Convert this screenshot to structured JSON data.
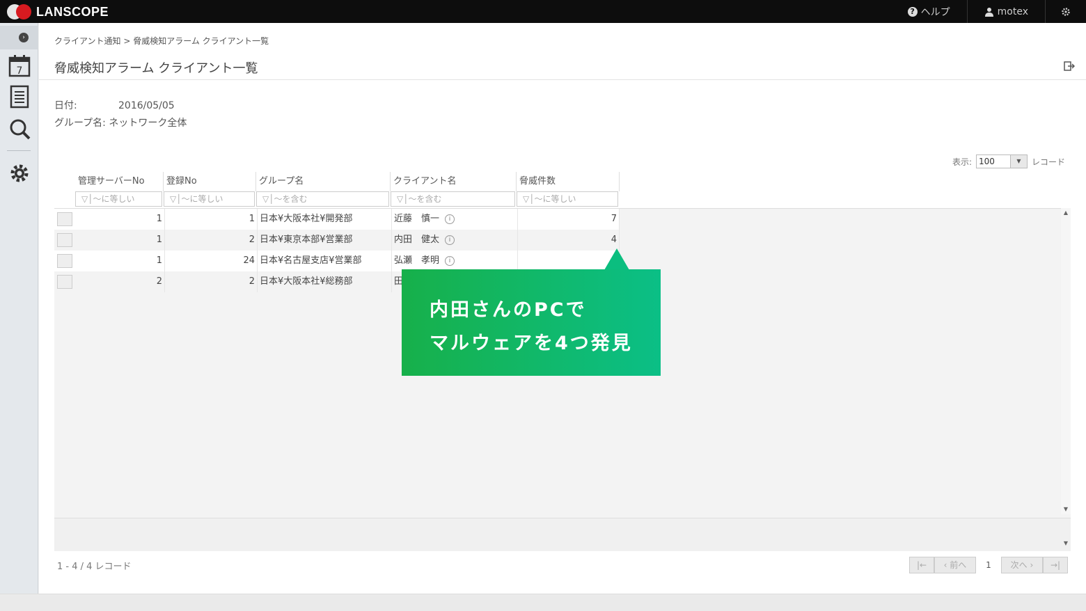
{
  "app": {
    "brand": "LANSCOPE",
    "help_label": "ヘルプ",
    "user_label": "motex"
  },
  "breadcrumb": {
    "text": "クライアント通知 > 脅威検知アラーム クライアント一覧"
  },
  "page": {
    "title": "脅威検知アラーム クライアント一覧"
  },
  "meta": {
    "date_label": "日付:",
    "date_value": "2016/05/05",
    "group_label": "グループ名:",
    "group_value": "ネットワーク全体"
  },
  "pagesize": {
    "label": "表示:",
    "value": "100",
    "suffix": "レコード"
  },
  "table": {
    "columns": [
      "管理サーバーNo",
      "登録No",
      "グループ名",
      "クライアント名",
      "脅威件数"
    ],
    "filters": [
      "▽│～に等しい",
      "▽│～に等しい",
      "▽│～を含む",
      "▽│～を含む",
      "▽│～に等しい"
    ],
    "rows": [
      {
        "server": "1",
        "reg": "1",
        "group": "日本¥大阪本社¥開発部",
        "client": "近藤　慎一",
        "count": "7"
      },
      {
        "server": "1",
        "reg": "2",
        "group": "日本¥東京本部¥営業部",
        "client": "内田　健太",
        "count": "4"
      },
      {
        "server": "1",
        "reg": "24",
        "group": "日本¥名古屋支店¥営業部",
        "client": "弘瀬　孝明",
        "count": ""
      },
      {
        "server": "2",
        "reg": "2",
        "group": "日本¥大阪本社¥総務部",
        "client": "田",
        "count": ""
      }
    ]
  },
  "footer": {
    "record_count": "1 - 4 / 4 レコード",
    "prev_label": "前へ",
    "page_number": "1",
    "next_label": "次へ"
  },
  "callout": {
    "line1": "内田さんのPCで",
    "line2": "マルウェアを4つ発見",
    "color_start": "#17b04a",
    "color_end": "#0bbf86"
  }
}
